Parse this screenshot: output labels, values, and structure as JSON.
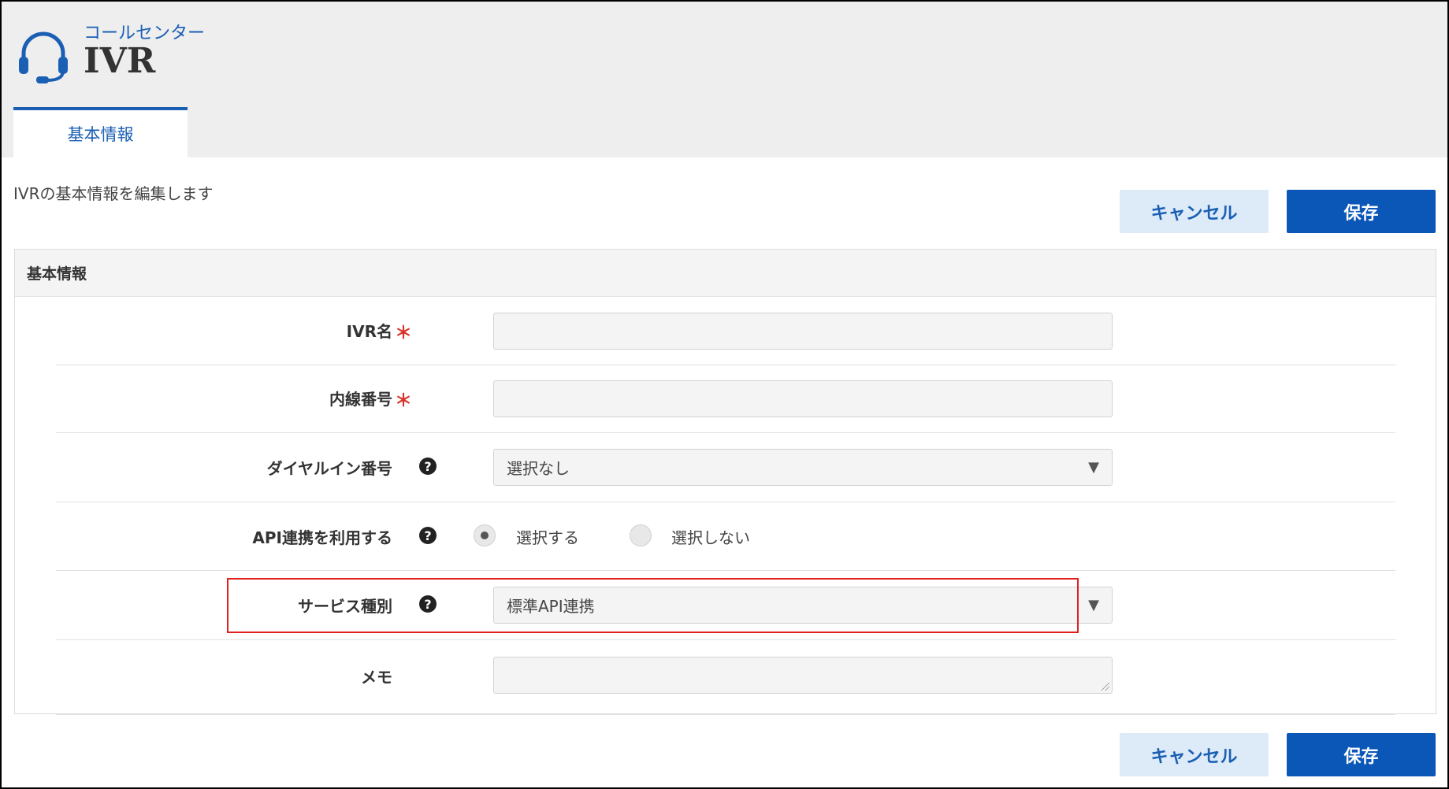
{
  "header": {
    "subtitle": "コールセンター",
    "title": "IVR",
    "icon": "headset-icon",
    "accent_color": "#1a5fb4"
  },
  "tabs": [
    {
      "label": "基本情報",
      "active": true
    }
  ],
  "page": {
    "description": "IVRの基本情報を編集します"
  },
  "actions": {
    "cancel_label": "キャンセル",
    "save_label": "保存"
  },
  "form": {
    "section_title": "基本情報",
    "required_mark": "＊",
    "help_glyph": "?",
    "fields": {
      "ivr_name": {
        "label": "IVR名",
        "value": "",
        "required": true
      },
      "extension": {
        "label": "内線番号",
        "value": "",
        "required": true
      },
      "dial_in": {
        "label": "ダイヤルイン番号",
        "selected": "選択なし"
      },
      "api": {
        "label": "API連携を利用する",
        "options": [
          "選択する",
          "選択しない"
        ],
        "selected": "選択する"
      },
      "service_type": {
        "label": "サービス種別",
        "selected": "標準API連携",
        "highlighted": true
      },
      "memo": {
        "label": "メモ",
        "value": ""
      }
    }
  }
}
